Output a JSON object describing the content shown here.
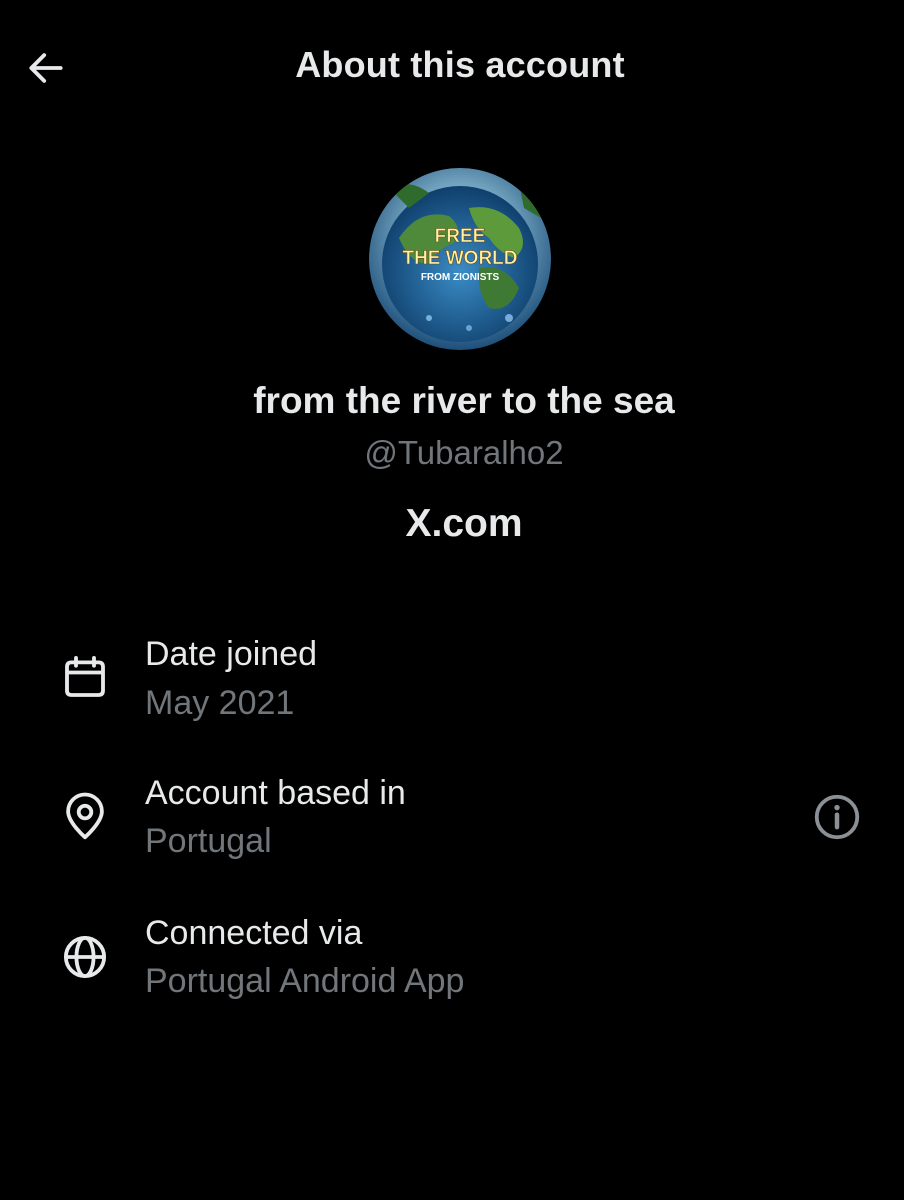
{
  "header": {
    "title": "About this account",
    "back_icon": "arrow-left-icon"
  },
  "profile": {
    "avatar_text_line1": "FREE",
    "avatar_text_line2": "THE WORLD",
    "avatar_text_line3": "FROM ZIONISTS",
    "display_name": "from the river to the sea",
    "handle": "@Tubaralho2",
    "platform": "X.com"
  },
  "details": [
    {
      "icon": "calendar-icon",
      "label": "Date joined",
      "value": "May 2021"
    },
    {
      "icon": "location-pin-icon",
      "label": "Account based in",
      "value": "Portugal",
      "trailing_icon": "info-circle-icon"
    },
    {
      "icon": "globe-icon",
      "label": "Connected via",
      "value": "Portugal Android App"
    }
  ],
  "colors": {
    "background": "#000000",
    "primary_text": "#e7e9ea",
    "secondary_text": "#71767b"
  }
}
